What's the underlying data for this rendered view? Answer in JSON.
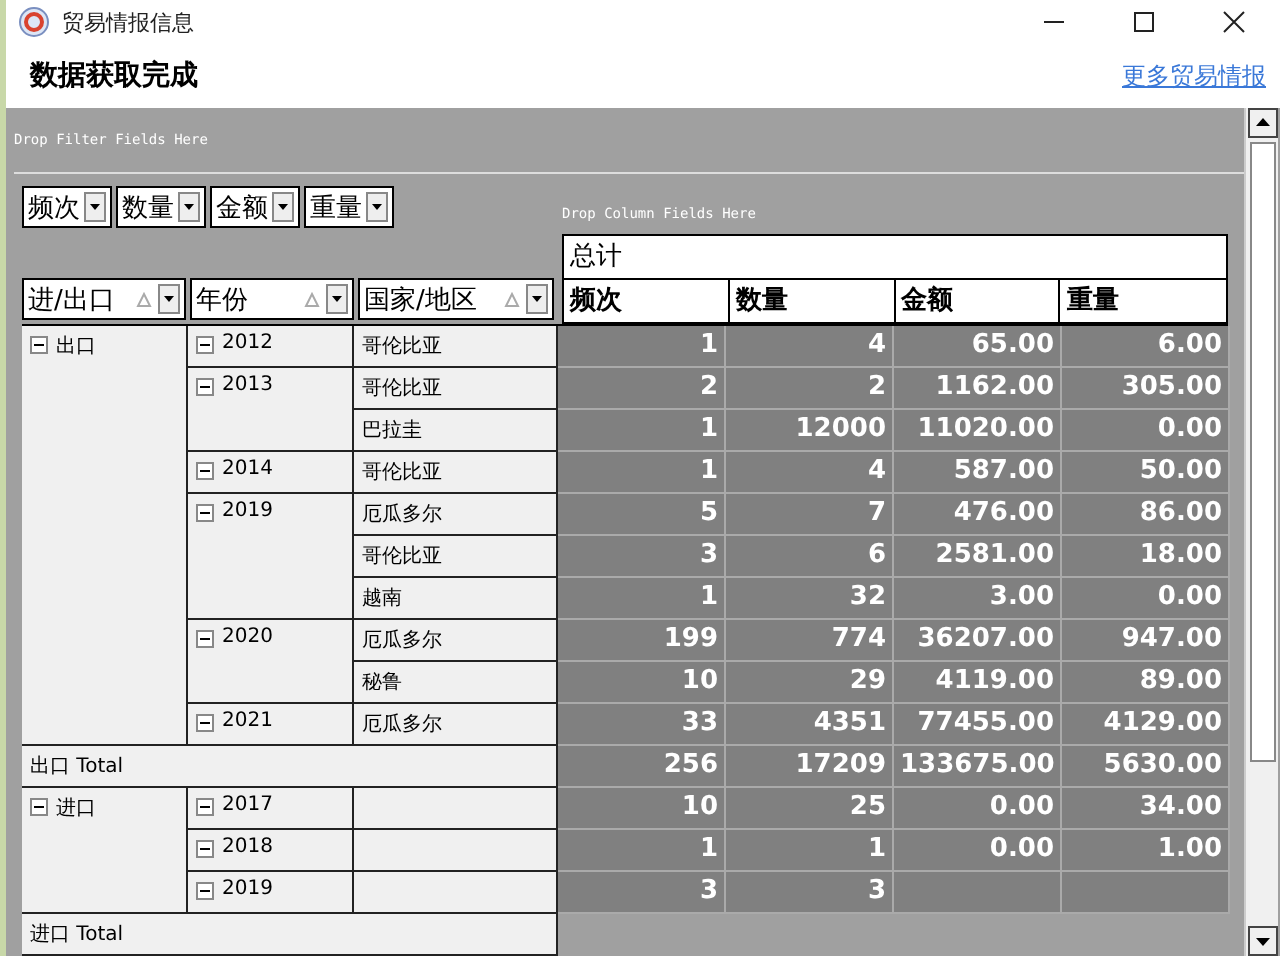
{
  "window": {
    "title": "贸易情报信息"
  },
  "header": {
    "status": "数据获取完成",
    "link": "更多贸易情报"
  },
  "pivot": {
    "filter_hint": "Drop Filter Fields Here",
    "column_hint": "Drop Column Fields Here",
    "data_fields": [
      "频次",
      "数量",
      "金额",
      "重量"
    ],
    "row_fields": [
      "进/出口",
      "年份",
      "国家/地区"
    ],
    "grand_total": "总计",
    "columns": [
      "频次",
      "数量",
      "金额",
      "重量"
    ],
    "groups": [
      {
        "label": "出口",
        "expanded": true,
        "years": [
          {
            "year": "2012",
            "expanded": true,
            "rows": [
              {
                "country": "哥伦比亚",
                "values": [
                  "1",
                  "4",
                  "65.00",
                  "6.00"
                ]
              }
            ]
          },
          {
            "year": "2013",
            "expanded": true,
            "rows": [
              {
                "country": "哥伦比亚",
                "values": [
                  "2",
                  "2",
                  "1162.00",
                  "305.00"
                ]
              },
              {
                "country": "巴拉圭",
                "values": [
                  "1",
                  "12000",
                  "11020.00",
                  "0.00"
                ]
              }
            ]
          },
          {
            "year": "2014",
            "expanded": true,
            "rows": [
              {
                "country": "哥伦比亚",
                "values": [
                  "1",
                  "4",
                  "587.00",
                  "50.00"
                ]
              }
            ]
          },
          {
            "year": "2019",
            "expanded": true,
            "rows": [
              {
                "country": "厄瓜多尔",
                "values": [
                  "5",
                  "7",
                  "476.00",
                  "86.00"
                ]
              },
              {
                "country": "哥伦比亚",
                "values": [
                  "3",
                  "6",
                  "2581.00",
                  "18.00"
                ]
              },
              {
                "country": "越南",
                "values": [
                  "1",
                  "32",
                  "3.00",
                  "0.00"
                ]
              }
            ]
          },
          {
            "year": "2020",
            "expanded": true,
            "rows": [
              {
                "country": "厄瓜多尔",
                "values": [
                  "199",
                  "774",
                  "36207.00",
                  "947.00"
                ]
              },
              {
                "country": "秘鲁",
                "values": [
                  "10",
                  "29",
                  "4119.00",
                  "89.00"
                ]
              }
            ]
          },
          {
            "year": "2021",
            "expanded": true,
            "rows": [
              {
                "country": "厄瓜多尔",
                "values": [
                  "33",
                  "4351",
                  "77455.00",
                  "4129.00"
                ]
              }
            ]
          }
        ],
        "total": {
          "label": "出口 Total",
          "values": [
            "256",
            "17209",
            "133675.00",
            "5630.00"
          ]
        }
      },
      {
        "label": "进口",
        "expanded": true,
        "years": [
          {
            "year": "2017",
            "expanded": true,
            "rows": [
              {
                "values": [
                  "10",
                  "25",
                  "0.00",
                  "34.00"
                ]
              }
            ]
          },
          {
            "year": "2018",
            "expanded": true,
            "rows": [
              {
                "values": [
                  "1",
                  "1",
                  "0.00",
                  "1.00"
                ]
              }
            ]
          },
          {
            "year": "2019",
            "expanded": true,
            "rows": [
              {
                "values": [
                  "3",
                  "3"
                ]
              }
            ]
          }
        ],
        "total": {
          "label": "进口 Total"
        }
      }
    ]
  }
}
